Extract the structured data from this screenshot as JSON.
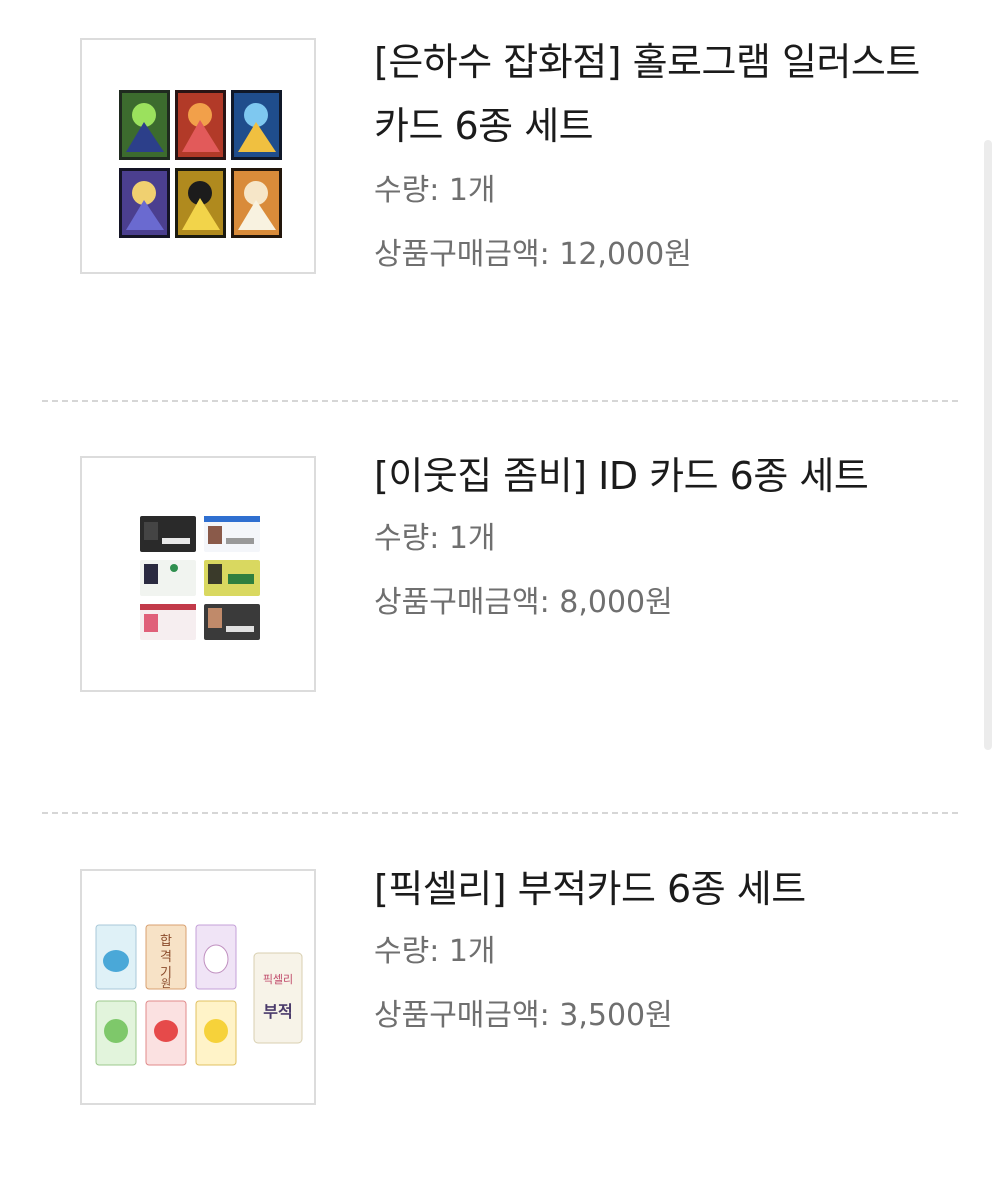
{
  "orders": [
    {
      "title": "[은하수 잡화점] 홀로그램 일러스트 카드 6종 세트",
      "quantity": "수량: 1개",
      "price": "상품구매금액: 12,000원",
      "thumbnail_icon": "hologram-card-set-image"
    },
    {
      "title": "[이웃집 좀비] ID 카드 6종 세트",
      "quantity": "수량: 1개",
      "price": "상품구매금액: 8,000원",
      "thumbnail_icon": "id-card-set-image"
    },
    {
      "title": "[픽셀리] 부적카드 6종 세트",
      "quantity": "수량: 1개",
      "price": "상품구매금액: 3,500원",
      "thumbnail_icon": "talisman-card-set-image",
      "thumbnail_text": [
        "합",
        "격",
        "기",
        "원",
        "픽셀리",
        "부적"
      ]
    }
  ]
}
